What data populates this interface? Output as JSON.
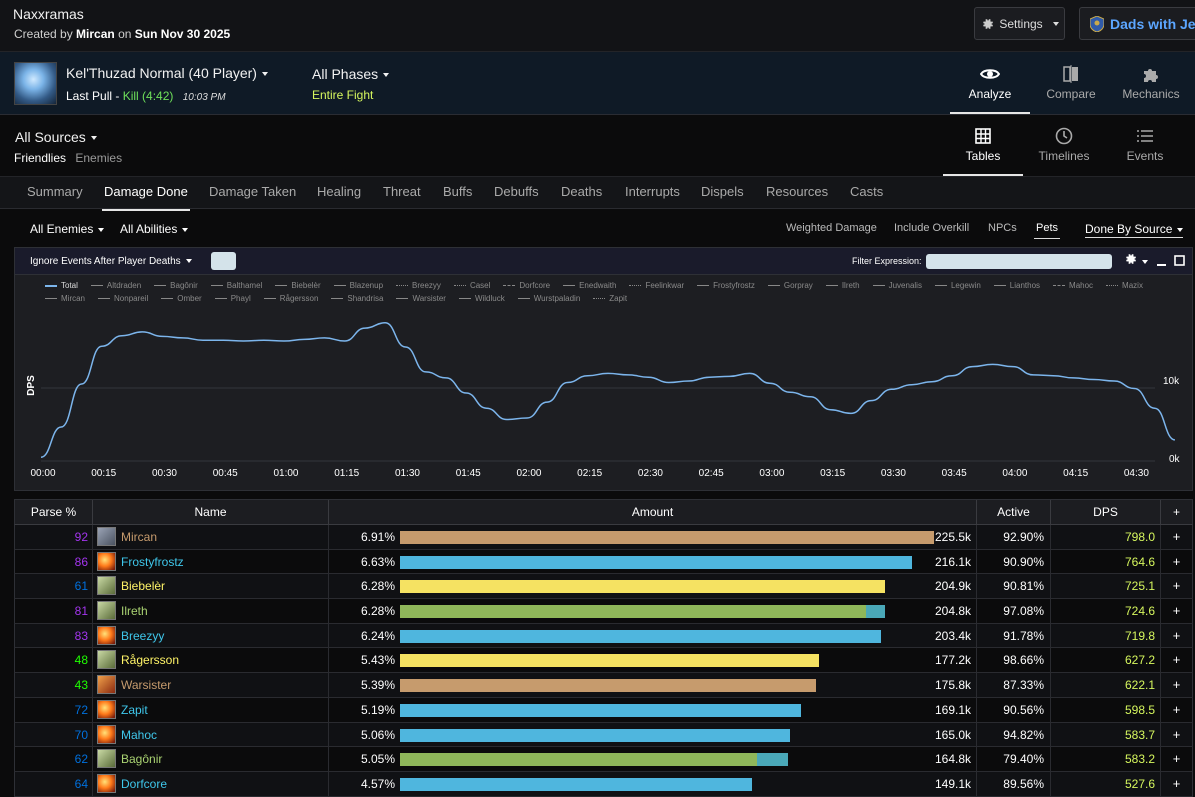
{
  "header": {
    "title": "Naxxramas",
    "created_prefix": "Created by",
    "creator": "Mircan",
    "created_on": "on",
    "date": "Sun Nov 30 2025",
    "settings_label": "Settings",
    "guild_label": "Dads with Je"
  },
  "fight": {
    "boss": "Kel'Thuzad Normal (40 Player)",
    "last_pull_label": "Last Pull -",
    "kill": "Kill (4:42)",
    "time": "10:03 PM",
    "phases": "All Phases",
    "phase_sub": "Entire Fight"
  },
  "mode_tabs": [
    {
      "label": "Analyze",
      "icon": "eye-icon"
    },
    {
      "label": "Compare",
      "icon": "compare-icon"
    },
    {
      "label": "Mechanics",
      "icon": "puzzle-icon"
    }
  ],
  "sources": {
    "title": "All Sources",
    "friendlies": "Friendlies",
    "enemies": "Enemies"
  },
  "view_tabs": [
    {
      "label": "Tables",
      "icon": "table-icon"
    },
    {
      "label": "Timelines",
      "icon": "clock-icon"
    },
    {
      "label": "Events",
      "icon": "list-icon"
    }
  ],
  "nav_tabs": [
    "Summary",
    "Damage Done",
    "Damage Taken",
    "Healing",
    "Threat",
    "Buffs",
    "Debuffs",
    "Deaths",
    "Interrupts",
    "Dispels",
    "Resources",
    "Casts"
  ],
  "filters": {
    "enemies": "All Enemies",
    "abilities": "All Abilities",
    "weighted": "Weighted Damage",
    "overkill": "Include Overkill",
    "npcs": "NPCs",
    "pets": "Pets",
    "done_by": "Done By Source"
  },
  "graph": {
    "ignore_label": "Ignore Events After Player Deaths",
    "filter_label": "Filter Expression:",
    "ylabel": "DPS",
    "ytick_top": "10k",
    "ytick_bottom": "0k",
    "legend": [
      "Total",
      "Altdraden",
      "Bagônir",
      "Balthamel",
      "Biebelèr",
      "Blazenup",
      "Breezyy",
      "Casel",
      "Dorfcore",
      "Enedwaith",
      "Feelinkwar",
      "Frostyfrostz",
      "Gorpray",
      "Ilreth",
      "Juvenalis",
      "Legewin",
      "Lianthos",
      "Mahoc",
      "Mazix",
      "Mircan",
      "Nonpareil",
      "Omber",
      "Phayl",
      "Rågersson",
      "Shandrisa",
      "Warsister",
      "Wildluck",
      "Wurstpaladin",
      "Zapit"
    ],
    "xticks": [
      "00:00",
      "00:15",
      "00:30",
      "00:45",
      "01:00",
      "01:15",
      "01:30",
      "01:45",
      "02:00",
      "02:15",
      "02:30",
      "02:45",
      "03:00",
      "03:15",
      "03:30",
      "03:45",
      "04:00",
      "04:15",
      "04:30"
    ]
  },
  "chart_data": {
    "type": "line",
    "ylabel": "DPS",
    "ylim": [
      0,
      20000
    ],
    "x_unit": "seconds",
    "series": [
      {
        "name": "Total",
        "x": [
          0,
          5,
          10,
          15,
          20,
          25,
          30,
          35,
          40,
          45,
          50,
          55,
          60,
          65,
          70,
          75,
          80,
          85,
          90,
          95,
          100,
          105,
          110,
          115,
          120,
          125,
          130,
          135,
          140,
          145,
          150,
          155,
          160,
          165,
          170,
          175,
          180,
          185,
          190,
          195,
          200,
          205,
          210,
          215,
          220,
          225,
          230,
          235,
          240,
          245,
          250,
          255,
          260,
          265,
          270,
          275,
          280
        ],
        "values": [
          500,
          4500,
          10200,
          15200,
          16600,
          17100,
          16500,
          16300,
          16000,
          16000,
          15900,
          16000,
          15900,
          16100,
          16300,
          15900,
          17600,
          18300,
          15100,
          11800,
          11000,
          9000,
          7000,
          5500,
          5700,
          7800,
          10400,
          11300,
          11600,
          11400,
          11100,
          10400,
          10600,
          11100,
          11200,
          11600,
          10300,
          9100,
          8500,
          6800,
          6300,
          8000,
          9500,
          10100,
          10500,
          11300,
          12500,
          12800,
          12500,
          11400,
          11300,
          11000,
          10800,
          10600,
          9600,
          7000,
          2800
        ]
      }
    ]
  },
  "table": {
    "headers": {
      "parse": "Parse %",
      "name": "Name",
      "amount": "Amount",
      "active": "Active",
      "dps": "DPS",
      "plus": "+"
    },
    "rows": [
      {
        "parse": "92",
        "parse_color": "#a335ee",
        "name": "Mircan",
        "name_color": "#c69b6d",
        "class": "warrior",
        "pct": "6.91%",
        "amount": "225.5k",
        "frac": 1.0,
        "pet_frac": 0,
        "bar_color": "#c69b6d",
        "active": "92.90%",
        "dps": "798.0",
        "plus": "+"
      },
      {
        "parse": "86",
        "parse_color": "#a335ee",
        "name": "Frostyfrostz",
        "name_color": "#3fc7eb",
        "class": "mage",
        "pct": "6.63%",
        "amount": "216.1k",
        "frac": 0.958,
        "pet_frac": 0,
        "bar_color": "#4fb6de",
        "active": "90.90%",
        "dps": "764.6",
        "plus": "+"
      },
      {
        "parse": "61",
        "parse_color": "#0070dd",
        "name": "Biebelèr",
        "name_color": "#fff468",
        "class": "rogue",
        "pct": "6.28%",
        "amount": "204.9k",
        "frac": 0.909,
        "pet_frac": 0,
        "bar_color": "#f5e262",
        "active": "90.81%",
        "dps": "725.1",
        "plus": "+"
      },
      {
        "parse": "81",
        "parse_color": "#a335ee",
        "name": "Ilreth",
        "name_color": "#aad372",
        "class": "hunter",
        "pct": "6.28%",
        "amount": "204.8k",
        "frac": 0.872,
        "pet_frac": 0.036,
        "bar_color": "#8fb75a",
        "active": "97.08%",
        "dps": "724.6",
        "plus": "+"
      },
      {
        "parse": "83",
        "parse_color": "#a335ee",
        "name": "Breezyy",
        "name_color": "#3fc7eb",
        "class": "mage",
        "pct": "6.24%",
        "amount": "203.4k",
        "frac": 0.901,
        "pet_frac": 0,
        "bar_color": "#4fb6de",
        "active": "91.78%",
        "dps": "719.8",
        "plus": "+"
      },
      {
        "parse": "48",
        "parse_color": "#1eff00",
        "name": "Rågersson",
        "name_color": "#fff468",
        "class": "rogue",
        "pct": "5.43%",
        "amount": "177.2k",
        "frac": 0.785,
        "pet_frac": 0,
        "bar_color": "#f5e262",
        "active": "98.66%",
        "dps": "627.2",
        "plus": "+"
      },
      {
        "parse": "43",
        "parse_color": "#1eff00",
        "name": "Warsister",
        "name_color": "#c69b6d",
        "class": "warrior",
        "pct": "5.39%",
        "amount": "175.8k",
        "frac": 0.779,
        "pet_frac": 0,
        "bar_color": "#c69b6d",
        "active": "87.33%",
        "dps": "622.1",
        "plus": "+"
      },
      {
        "parse": "72",
        "parse_color": "#0070dd",
        "name": "Zapit",
        "name_color": "#3fc7eb",
        "class": "mage",
        "pct": "5.19%",
        "amount": "169.1k",
        "frac": 0.75,
        "pet_frac": 0,
        "bar_color": "#4fb6de",
        "active": "90.56%",
        "dps": "598.5",
        "plus": "+"
      },
      {
        "parse": "70",
        "parse_color": "#0070dd",
        "name": "Mahoc",
        "name_color": "#3fc7eb",
        "class": "mage",
        "pct": "5.06%",
        "amount": "165.0k",
        "frac": 0.731,
        "pet_frac": 0,
        "bar_color": "#4fb6de",
        "active": "94.82%",
        "dps": "583.7",
        "plus": "+"
      },
      {
        "parse": "62",
        "parse_color": "#0070dd",
        "name": "Bagônir",
        "name_color": "#aad372",
        "class": "hunter",
        "pct": "5.05%",
        "amount": "164.8k",
        "frac": 0.669,
        "pet_frac": 0.058,
        "bar_color": "#8fb75a",
        "active": "79.40%",
        "dps": "583.2",
        "plus": "+"
      },
      {
        "parse": "64",
        "parse_color": "#0070dd",
        "name": "Dorfcore",
        "name_color": "#3fc7eb",
        "class": "mage",
        "pct": "4.57%",
        "amount": "149.1k",
        "frac": 0.66,
        "pet_frac": 0,
        "bar_color": "#4fb6de",
        "active": "89.56%",
        "dps": "527.6",
        "plus": "+"
      }
    ]
  },
  "colors": {
    "accent": "#d6f75e",
    "kill": "#6ee05a",
    "link": "#5ca6ff",
    "line": "#7cb5ec",
    "pet_bar": "#4aa8b8"
  }
}
